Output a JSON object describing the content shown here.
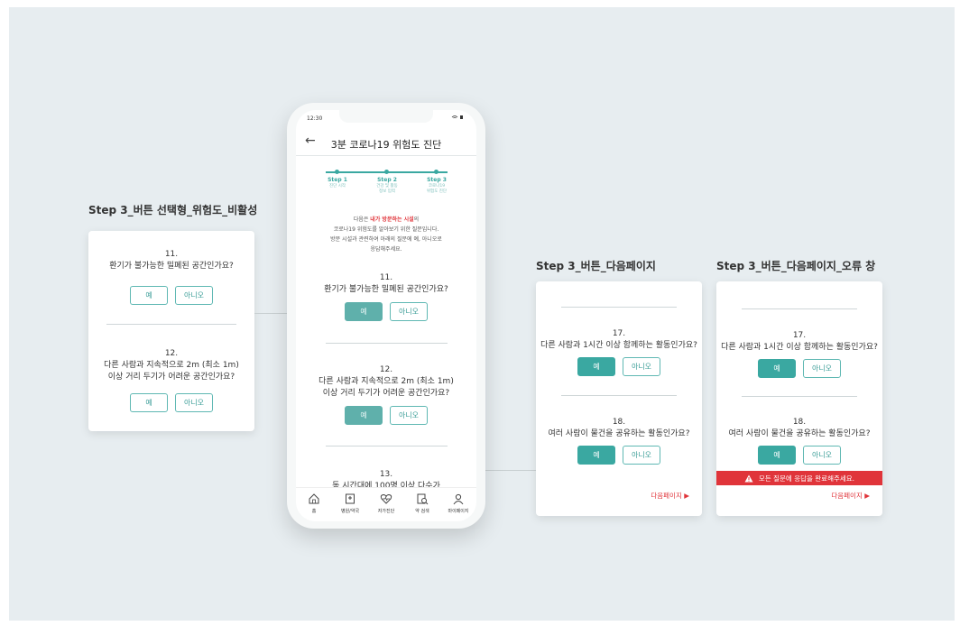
{
  "labels": {
    "left": "Step 3_버튼 선택형_위험도_비활성",
    "mid": "Step 3_버튼_다음페이지",
    "right": "Step 3_버튼_다음페이지_오류 창"
  },
  "phone": {
    "time": "12:30",
    "title": "3분 코로나19 위험도 진단",
    "steps": [
      {
        "label": "Step 1",
        "sub1": "진단 시작",
        "sub2": ""
      },
      {
        "label": "Step 2",
        "sub1": "건강 및 활동",
        "sub2": "정보 입력"
      },
      {
        "label": "Step 3",
        "sub1": "코로나19",
        "sub2": "위험도 진단"
      }
    ],
    "intro_prefix": "다음은 ",
    "intro_highlight": "내가 방문하는 시설",
    "intro_suffix": "의",
    "intro_line2": "코로나19 위험도를 알아보기 위한 질문입니다.",
    "intro_line3": "방문 시설과 관련하여 아래의 질문에 예, 아니오로",
    "intro_line4": "응답해주세요.",
    "q11_num": "11.",
    "q11_text": "환기가 불가능한 밀폐된 공간인가요?",
    "q12_num": "12.",
    "q12_line1": "다른 사람과 지속적으로 2m (최소 1m)",
    "q12_line2": "이상 거리 두기가 어려운 공간인가요?",
    "q13_num": "13.",
    "q13_text": "동 시간대에 100명 이상 다수가",
    "tabs": [
      "홈",
      "병원/약국",
      "자가진단",
      "약 검색",
      "마이페이지"
    ]
  },
  "buttons": {
    "yes": "예",
    "no": "아니오"
  },
  "left_card": {
    "q11_num": "11.",
    "q11_text": "환기가 불가능한 밀폐된 공간인가요?",
    "q12_num": "12.",
    "q12_line1": "다른 사람과 지속적으로 2m (최소 1m)",
    "q12_line2": "이상 거리 두기가 어려운 공간인가요?"
  },
  "mid_card": {
    "q17_num": "17.",
    "q17_text": "다른 사람과 1시간 이상 함께하는 활동인가요?",
    "q18_num": "18.",
    "q18_text": "여러 사람이 물건을 공유하는 활동인가요?",
    "next": "다음페이지 ▶"
  },
  "right_card": {
    "q17_num": "17.",
    "q17_text": "다른 사람과 1시간 이상 함께하는 활동인가요?",
    "q18_num": "18.",
    "q18_text": "여러 사람이 물건을 공유하는 활동인가요?",
    "error": "모든 질문에 응답을 완료해주세요.",
    "next": "다음페이지 ▶"
  },
  "colors": {
    "teal": "#3aa8a1",
    "red": "#e0343a",
    "background": "#e7edf0"
  }
}
